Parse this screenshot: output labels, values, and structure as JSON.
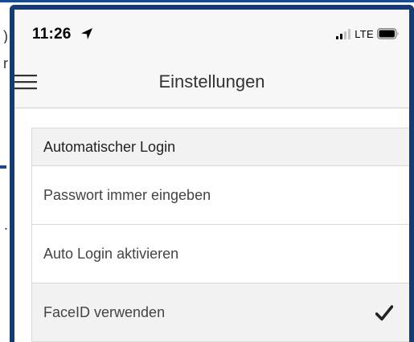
{
  "background": {
    "fragments": [
      ")",
      "r",
      "."
    ],
    "accent_color": "#1a4a8e"
  },
  "status_bar": {
    "time": "11:26",
    "location_icon": "location-arrow-icon",
    "signal_icon": "cellular-signal-icon",
    "network": "LTE",
    "battery_icon": "battery-icon"
  },
  "nav": {
    "menu_icon": "hamburger-menu-icon",
    "title": "Einstellungen"
  },
  "settings": {
    "section_header": "Automatischer Login",
    "items": [
      {
        "label": "Passwort immer eingeben",
        "selected": false
      },
      {
        "label": "Auto Login aktivieren",
        "selected": false
      },
      {
        "label": "FaceID verwenden",
        "selected": true
      }
    ],
    "check_icon": "checkmark-icon"
  },
  "colors": {
    "frame": "#143c73",
    "nav_background": "#f7f7f7",
    "selected_row": "#f2f2f2",
    "divider": "#d9d9d9"
  }
}
